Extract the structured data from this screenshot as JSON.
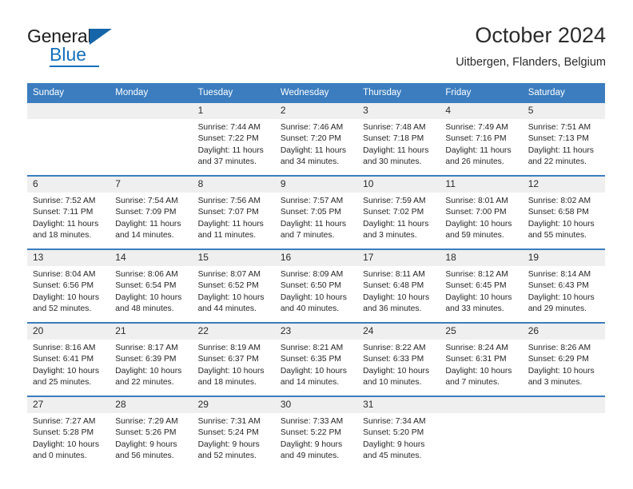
{
  "brand": {
    "name_top": "General",
    "name_bottom": "Blue",
    "triangle_color": "#1565a8",
    "blue_color": "#1671bd"
  },
  "header": {
    "title": "October 2024",
    "subtitle": "Uitbergen, Flanders, Belgium"
  },
  "theme": {
    "header_blue": "#3b7dbf",
    "daynum_gray": "#efefef",
    "text": "#262626"
  },
  "weekday_headers": [
    "Sunday",
    "Monday",
    "Tuesday",
    "Wednesday",
    "Thursday",
    "Friday",
    "Saturday"
  ],
  "labels": {
    "sunrise": "Sunrise:",
    "sunset": "Sunset:",
    "daylight": "Daylight:"
  },
  "weeks": [
    [
      {
        "day": "",
        "sunrise": "",
        "sunset": "",
        "daylight": ""
      },
      {
        "day": "",
        "sunrise": "",
        "sunset": "",
        "daylight": ""
      },
      {
        "day": "1",
        "sunrise": "Sunrise: 7:44 AM",
        "sunset": "Sunset: 7:22 PM",
        "daylight": "Daylight: 11 hours and 37 minutes."
      },
      {
        "day": "2",
        "sunrise": "Sunrise: 7:46 AM",
        "sunset": "Sunset: 7:20 PM",
        "daylight": "Daylight: 11 hours and 34 minutes."
      },
      {
        "day": "3",
        "sunrise": "Sunrise: 7:48 AM",
        "sunset": "Sunset: 7:18 PM",
        "daylight": "Daylight: 11 hours and 30 minutes."
      },
      {
        "day": "4",
        "sunrise": "Sunrise: 7:49 AM",
        "sunset": "Sunset: 7:16 PM",
        "daylight": "Daylight: 11 hours and 26 minutes."
      },
      {
        "day": "5",
        "sunrise": "Sunrise: 7:51 AM",
        "sunset": "Sunset: 7:13 PM",
        "daylight": "Daylight: 11 hours and 22 minutes."
      }
    ],
    [
      {
        "day": "6",
        "sunrise": "Sunrise: 7:52 AM",
        "sunset": "Sunset: 7:11 PM",
        "daylight": "Daylight: 11 hours and 18 minutes."
      },
      {
        "day": "7",
        "sunrise": "Sunrise: 7:54 AM",
        "sunset": "Sunset: 7:09 PM",
        "daylight": "Daylight: 11 hours and 14 minutes."
      },
      {
        "day": "8",
        "sunrise": "Sunrise: 7:56 AM",
        "sunset": "Sunset: 7:07 PM",
        "daylight": "Daylight: 11 hours and 11 minutes."
      },
      {
        "day": "9",
        "sunrise": "Sunrise: 7:57 AM",
        "sunset": "Sunset: 7:05 PM",
        "daylight": "Daylight: 11 hours and 7 minutes."
      },
      {
        "day": "10",
        "sunrise": "Sunrise: 7:59 AM",
        "sunset": "Sunset: 7:02 PM",
        "daylight": "Daylight: 11 hours and 3 minutes."
      },
      {
        "day": "11",
        "sunrise": "Sunrise: 8:01 AM",
        "sunset": "Sunset: 7:00 PM",
        "daylight": "Daylight: 10 hours and 59 minutes."
      },
      {
        "day": "12",
        "sunrise": "Sunrise: 8:02 AM",
        "sunset": "Sunset: 6:58 PM",
        "daylight": "Daylight: 10 hours and 55 minutes."
      }
    ],
    [
      {
        "day": "13",
        "sunrise": "Sunrise: 8:04 AM",
        "sunset": "Sunset: 6:56 PM",
        "daylight": "Daylight: 10 hours and 52 minutes."
      },
      {
        "day": "14",
        "sunrise": "Sunrise: 8:06 AM",
        "sunset": "Sunset: 6:54 PM",
        "daylight": "Daylight: 10 hours and 48 minutes."
      },
      {
        "day": "15",
        "sunrise": "Sunrise: 8:07 AM",
        "sunset": "Sunset: 6:52 PM",
        "daylight": "Daylight: 10 hours and 44 minutes."
      },
      {
        "day": "16",
        "sunrise": "Sunrise: 8:09 AM",
        "sunset": "Sunset: 6:50 PM",
        "daylight": "Daylight: 10 hours and 40 minutes."
      },
      {
        "day": "17",
        "sunrise": "Sunrise: 8:11 AM",
        "sunset": "Sunset: 6:48 PM",
        "daylight": "Daylight: 10 hours and 36 minutes."
      },
      {
        "day": "18",
        "sunrise": "Sunrise: 8:12 AM",
        "sunset": "Sunset: 6:45 PM",
        "daylight": "Daylight: 10 hours and 33 minutes."
      },
      {
        "day": "19",
        "sunrise": "Sunrise: 8:14 AM",
        "sunset": "Sunset: 6:43 PM",
        "daylight": "Daylight: 10 hours and 29 minutes."
      }
    ],
    [
      {
        "day": "20",
        "sunrise": "Sunrise: 8:16 AM",
        "sunset": "Sunset: 6:41 PM",
        "daylight": "Daylight: 10 hours and 25 minutes."
      },
      {
        "day": "21",
        "sunrise": "Sunrise: 8:17 AM",
        "sunset": "Sunset: 6:39 PM",
        "daylight": "Daylight: 10 hours and 22 minutes."
      },
      {
        "day": "22",
        "sunrise": "Sunrise: 8:19 AM",
        "sunset": "Sunset: 6:37 PM",
        "daylight": "Daylight: 10 hours and 18 minutes."
      },
      {
        "day": "23",
        "sunrise": "Sunrise: 8:21 AM",
        "sunset": "Sunset: 6:35 PM",
        "daylight": "Daylight: 10 hours and 14 minutes."
      },
      {
        "day": "24",
        "sunrise": "Sunrise: 8:22 AM",
        "sunset": "Sunset: 6:33 PM",
        "daylight": "Daylight: 10 hours and 10 minutes."
      },
      {
        "day": "25",
        "sunrise": "Sunrise: 8:24 AM",
        "sunset": "Sunset: 6:31 PM",
        "daylight": "Daylight: 10 hours and 7 minutes."
      },
      {
        "day": "26",
        "sunrise": "Sunrise: 8:26 AM",
        "sunset": "Sunset: 6:29 PM",
        "daylight": "Daylight: 10 hours and 3 minutes."
      }
    ],
    [
      {
        "day": "27",
        "sunrise": "Sunrise: 7:27 AM",
        "sunset": "Sunset: 5:28 PM",
        "daylight": "Daylight: 10 hours and 0 minutes."
      },
      {
        "day": "28",
        "sunrise": "Sunrise: 7:29 AM",
        "sunset": "Sunset: 5:26 PM",
        "daylight": "Daylight: 9 hours and 56 minutes."
      },
      {
        "day": "29",
        "sunrise": "Sunrise: 7:31 AM",
        "sunset": "Sunset: 5:24 PM",
        "daylight": "Daylight: 9 hours and 52 minutes."
      },
      {
        "day": "30",
        "sunrise": "Sunrise: 7:33 AM",
        "sunset": "Sunset: 5:22 PM",
        "daylight": "Daylight: 9 hours and 49 minutes."
      },
      {
        "day": "31",
        "sunrise": "Sunrise: 7:34 AM",
        "sunset": "Sunset: 5:20 PM",
        "daylight": "Daylight: 9 hours and 45 minutes."
      },
      {
        "day": "",
        "sunrise": "",
        "sunset": "",
        "daylight": ""
      },
      {
        "day": "",
        "sunrise": "",
        "sunset": "",
        "daylight": ""
      }
    ]
  ]
}
